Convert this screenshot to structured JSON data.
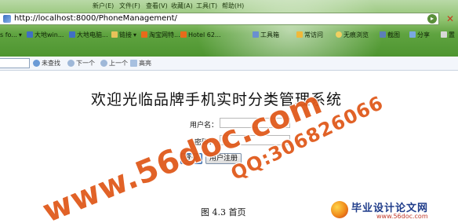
{
  "browser": {
    "menu": [
      "新户(E)",
      "文件(F)",
      "查看(V)",
      "收藏(A)",
      "工具(T)",
      "帮助(H)"
    ],
    "address": "http://localhost:8000/PhoneManagement/",
    "close_symbol": "✕",
    "favorites_left": [
      {
        "label": "s fo...",
        "icon": "page-icon"
      },
      {
        "label": "大地win...",
        "icon": "page-icon"
      },
      {
        "label": "大地电脑...",
        "icon": "page-icon"
      },
      {
        "label": "链接",
        "icon": "folder-icon"
      },
      {
        "label": "淘宝网特...",
        "icon": "page-icon"
      },
      {
        "label": "Hotel 62...",
        "icon": "page-icon"
      }
    ],
    "toolbar_right": [
      {
        "label": "工具箱",
        "icon": "toolbox-icon"
      },
      {
        "label": "常访问",
        "icon": "star-icon"
      },
      {
        "label": "无痕浏览",
        "icon": "incognito-icon"
      },
      {
        "label": "截图",
        "icon": "scissors-icon"
      },
      {
        "label": "分享",
        "icon": "share-icon"
      },
      {
        "label": "置",
        "icon": "settings-icon"
      }
    ],
    "find_bar": {
      "search_label": "未查找",
      "next_label": "下一个",
      "prev_label": "上一个",
      "highlight_label": "高亮"
    }
  },
  "page": {
    "title": "欢迎光临品牌手机实时分类管理系统",
    "username_label": "用户名：",
    "password_label": "密码：",
    "username_value": "",
    "password_value": "",
    "login_button": "登录",
    "register_button": "用户注册"
  },
  "caption": "图 4.3    首页",
  "watermarks": {
    "site": "www.56doc.com",
    "qq": "QQ:306826066",
    "logo_title": "毕业设计论文网",
    "logo_url": "www.56doc.com"
  },
  "colors": {
    "chrome_green": "#5fa340",
    "watermark_orange": "#e05a1c",
    "logo_blue": "#1f3c8a"
  }
}
